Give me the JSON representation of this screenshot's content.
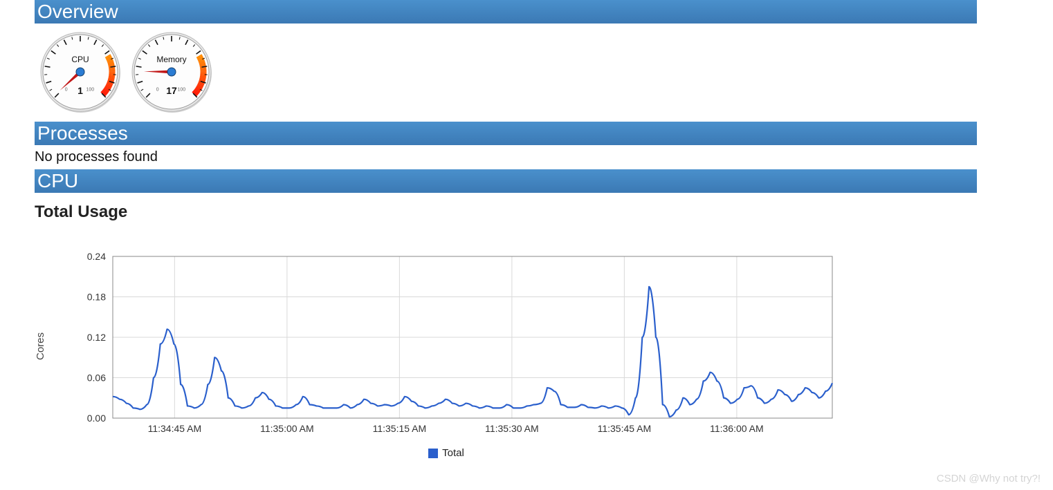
{
  "sections": {
    "overview": "Overview",
    "processes": "Processes",
    "cpu": "CPU"
  },
  "gauges": {
    "cpu": {
      "label": "CPU",
      "value": 1,
      "min": 0,
      "max": 100,
      "minLabel": "0",
      "maxLabel": "100"
    },
    "memory": {
      "label": "Memory",
      "value": 17,
      "min": 0,
      "max": 100,
      "minLabel": "0",
      "maxLabel": "100"
    }
  },
  "processes_message": "No processes found",
  "cpu_section": {
    "subtitle": "Total Usage",
    "ylabel": "Cores",
    "legend": "Total"
  },
  "chart_data": {
    "type": "line",
    "title": "Total Usage",
    "xlabel": "",
    "ylabel": "Cores",
    "ylim": [
      0.0,
      0.24
    ],
    "yticks": [
      0.0,
      0.06,
      0.12,
      0.18,
      0.24
    ],
    "xticks": [
      "11:34:45 AM",
      "11:35:00 AM",
      "11:35:15 AM",
      "11:35:30 AM",
      "11:35:45 AM",
      "11:36:00 AM"
    ],
    "series": [
      {
        "name": "Total",
        "color": "#2a5fcc",
        "values": [
          0.032,
          0.028,
          0.022,
          0.015,
          0.013,
          0.02,
          0.06,
          0.11,
          0.132,
          0.11,
          0.05,
          0.018,
          0.015,
          0.02,
          0.05,
          0.09,
          0.07,
          0.03,
          0.018,
          0.015,
          0.018,
          0.03,
          0.038,
          0.028,
          0.018,
          0.015,
          0.015,
          0.02,
          0.032,
          0.02,
          0.018,
          0.015,
          0.015,
          0.015,
          0.02,
          0.015,
          0.02,
          0.028,
          0.022,
          0.018,
          0.02,
          0.018,
          0.022,
          0.032,
          0.025,
          0.018,
          0.015,
          0.018,
          0.022,
          0.028,
          0.022,
          0.018,
          0.022,
          0.018,
          0.015,
          0.018,
          0.015,
          0.015,
          0.02,
          0.015,
          0.015,
          0.018,
          0.02,
          0.022,
          0.045,
          0.04,
          0.02,
          0.016,
          0.016,
          0.02,
          0.016,
          0.015,
          0.018,
          0.015,
          0.018,
          0.015,
          0.005,
          0.03,
          0.12,
          0.195,
          0.12,
          0.02,
          0.002,
          0.012,
          0.03,
          0.02,
          0.028,
          0.055,
          0.068,
          0.055,
          0.03,
          0.022,
          0.028,
          0.045,
          0.048,
          0.03,
          0.022,
          0.028,
          0.042,
          0.035,
          0.025,
          0.035,
          0.045,
          0.038,
          0.03,
          0.04,
          0.052
        ]
      }
    ]
  },
  "watermark": "CSDN @Why not try?!"
}
